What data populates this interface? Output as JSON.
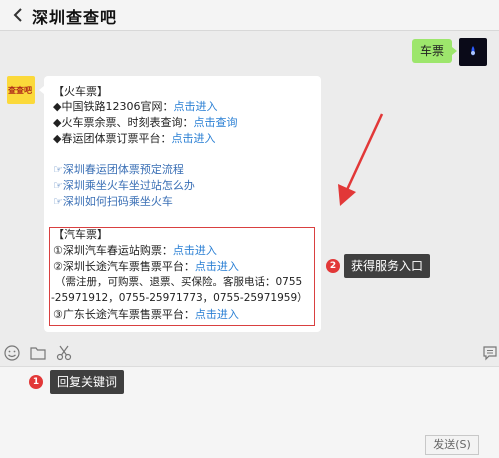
{
  "header": {
    "title": "深圳查查吧"
  },
  "chat": {
    "user_message": "车票",
    "bot_avatar_text": "查查吧",
    "train_heading": "【火车票】",
    "train_items": [
      {
        "prefix": "◆中国铁路12306官网：",
        "link": "点击进入"
      },
      {
        "prefix": "◆火车票余票、时刻表查询：",
        "link": "点击查询"
      },
      {
        "prefix": "◆春运团体票订票平台：",
        "link": "点击进入"
      }
    ],
    "articles": [
      "☞深圳春运团体票预定流程",
      "☞深圳乘坐火车坐过站怎么办",
      "☞深圳如何扫码乘坐火车"
    ],
    "bus_heading": "【汽车票】",
    "bus_items": [
      {
        "prefix": "①深圳汽车春运站购票：",
        "link": "点击进入"
      },
      {
        "prefix": "②深圳长途汽车票售票平台：",
        "link": "点击进入"
      }
    ],
    "bus_note_1": "（需注册，可购票、退票、买保险。客服电话：0755",
    "bus_note_2": "-25971912，0755-25971773，0755-25971959）",
    "bus_item_3": {
      "prefix": "③广东长途汽车票售票平台：",
      "link": "点击进入"
    }
  },
  "annotations": [
    {
      "number": "1",
      "text": "回复关键词"
    },
    {
      "number": "2",
      "text": "获得服务入口"
    }
  ],
  "input": {
    "send_label": "发送(S)"
  },
  "colors": {
    "link": "#2a7fd4",
    "user_bubble": "#9de66c",
    "box": "#d94040",
    "badge": "#e23838"
  },
  "icons": [
    "back-arrow-icon",
    "emoji-icon",
    "folder-icon",
    "scissors-icon",
    "chat-history-icon"
  ]
}
